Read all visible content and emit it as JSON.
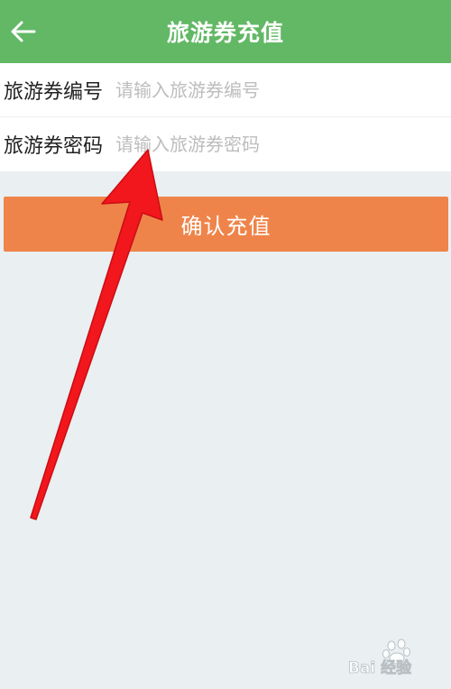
{
  "header": {
    "title": "旅游券充值",
    "back_icon": "arrow-left-icon"
  },
  "form": {
    "voucher_number": {
      "label": "旅游券编号",
      "placeholder": "请输入旅游券编号",
      "value": ""
    },
    "voucher_password": {
      "label": "旅游券密码",
      "placeholder": "请输入旅游券密码",
      "value": ""
    }
  },
  "confirm_button": {
    "label": "确认充值"
  },
  "colors": {
    "header_bg": "#62b865",
    "button_bg": "#ef844a",
    "page_bg": "#eaeff1",
    "annotation_arrow": "#f2161d"
  },
  "watermark": {
    "text": "Bai 经验",
    "icon": "baidu-paw-icon"
  }
}
